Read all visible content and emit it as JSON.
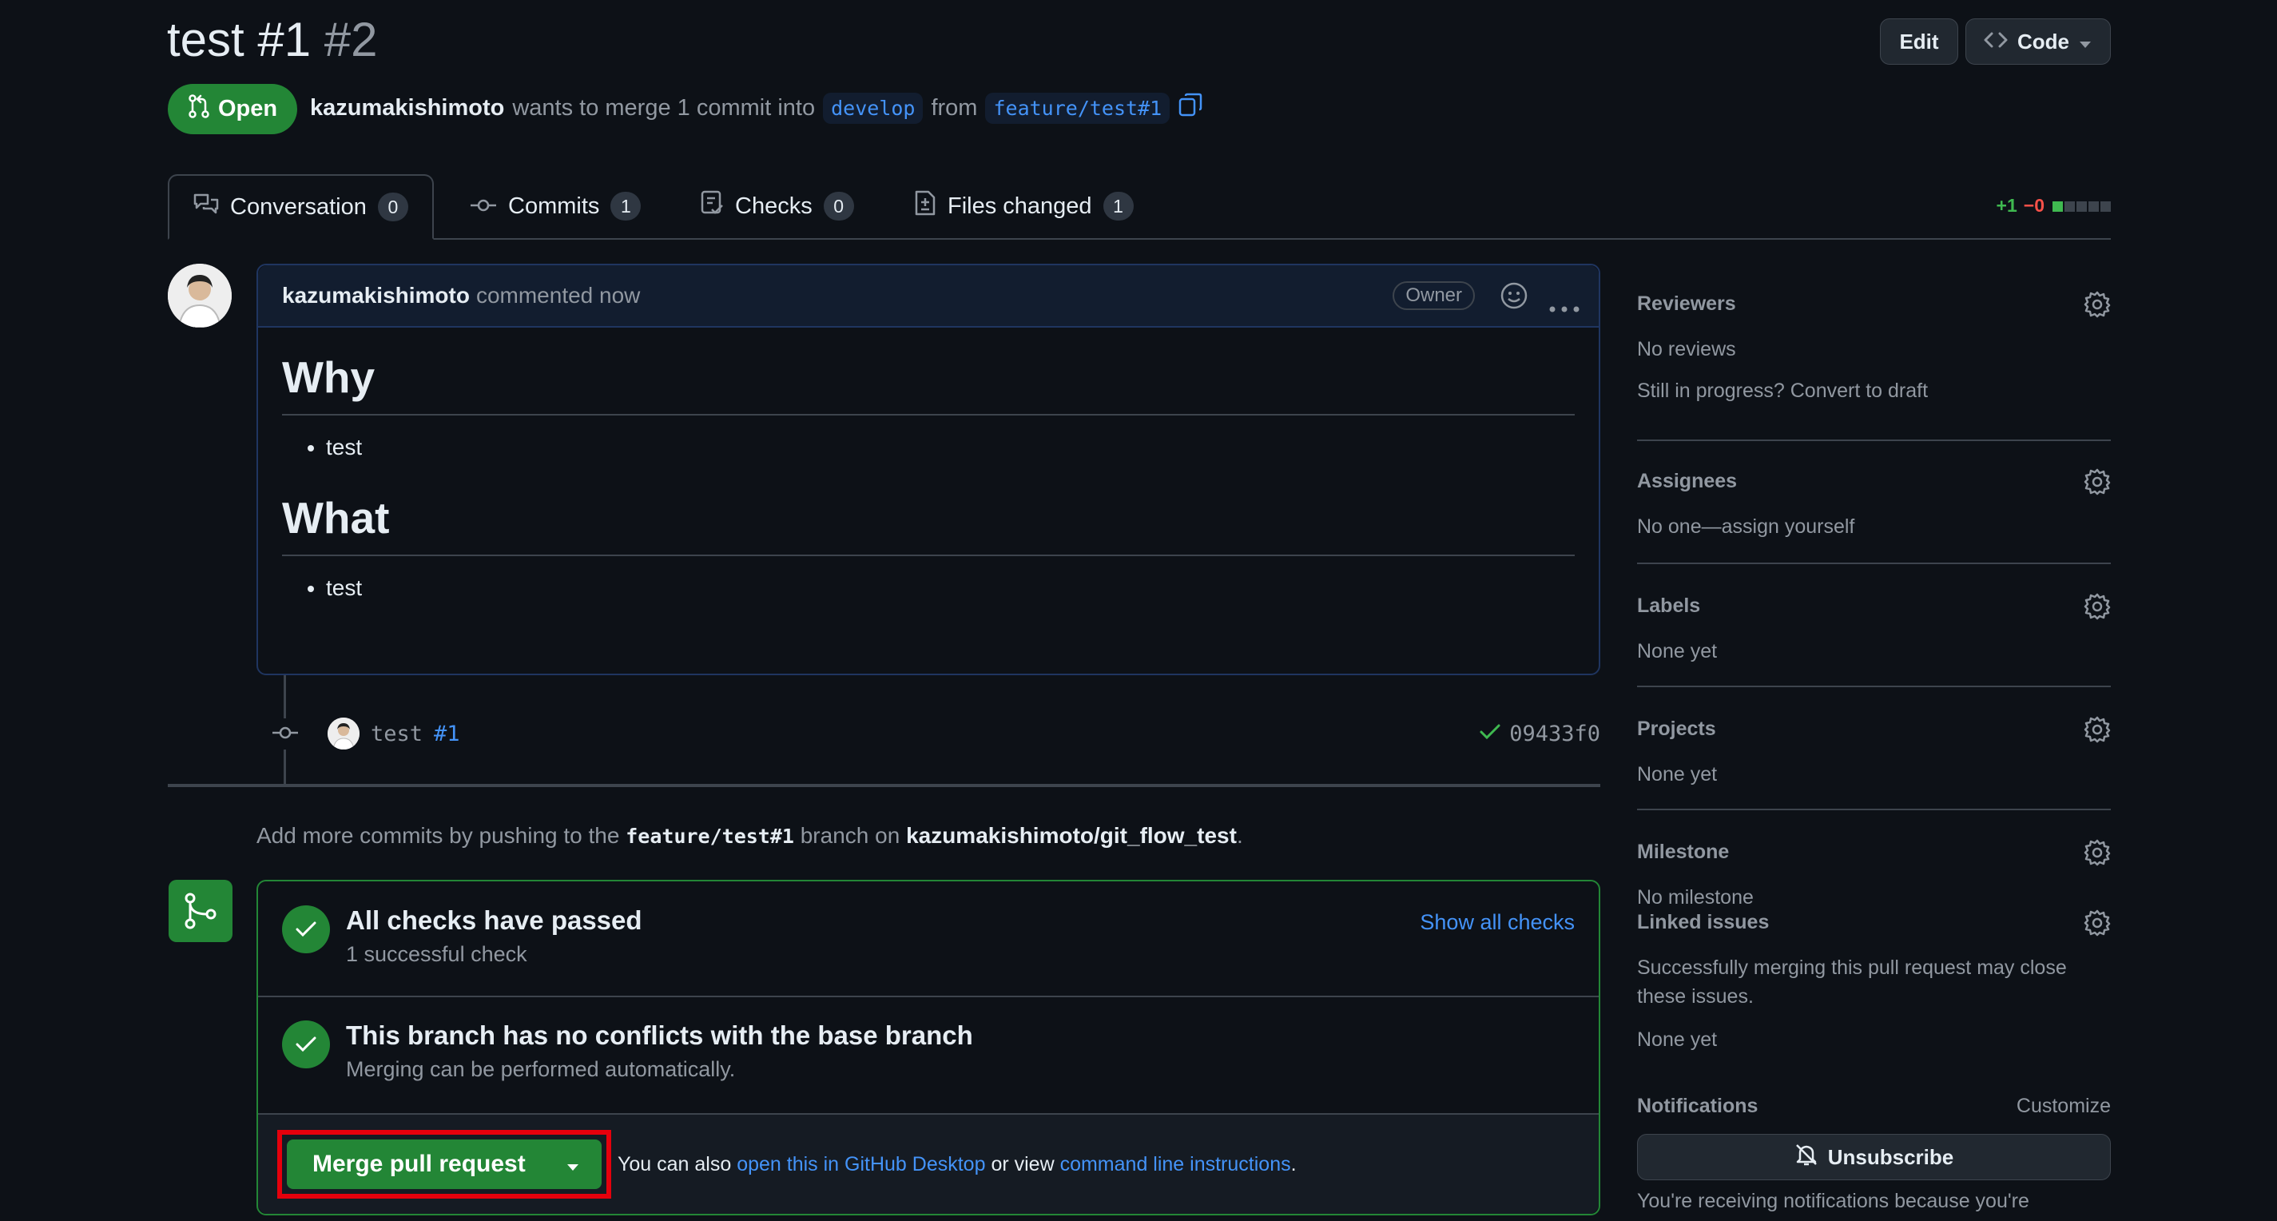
{
  "header": {
    "title": "test #1",
    "number": "#2",
    "edit_label": "Edit",
    "code_label": "Code",
    "state": "Open",
    "author": "kazumakishimoto",
    "merge_text": "wants to merge 1 commit into",
    "base_branch": "develop",
    "from_text": "from",
    "head_branch": "feature/test#1"
  },
  "tabs": [
    {
      "label": "Conversation",
      "count": "0"
    },
    {
      "label": "Commits",
      "count": "1"
    },
    {
      "label": "Checks",
      "count": "0"
    },
    {
      "label": "Files changed",
      "count": "1"
    }
  ],
  "diffstat": {
    "additions": "+1",
    "deletions": "−0"
  },
  "comment": {
    "author": "kazumakishimoto",
    "time": "commented now",
    "badge": "Owner",
    "h1": "Why",
    "item1": "test",
    "h2": "What",
    "item2": "test"
  },
  "commit": {
    "message": "test",
    "ref": "#1",
    "sha": "09433f0"
  },
  "hint": {
    "prefix": "Add more commits by pushing to the",
    "branch": "feature/test#1",
    "middle": "branch on",
    "repo": "kazumakishimoto/git_flow_test",
    "suffix": "."
  },
  "checks": {
    "title": "All checks have passed",
    "sub": "1 successful check",
    "show_all": "Show all checks"
  },
  "conflicts": {
    "title": "This branch has no conflicts with the base branch",
    "sub": "Merging can be performed automatically."
  },
  "merge": {
    "button": "Merge pull request",
    "also": "You can also",
    "desktop_link": "open this in GitHub Desktop",
    "or_view": "or view",
    "cli_link": "command line instructions",
    "end": "."
  },
  "sidebar": {
    "reviewers": {
      "title": "Reviewers",
      "text": "No reviews",
      "text2": "Still in progress? Convert to draft"
    },
    "assignees": {
      "title": "Assignees",
      "text": "No one—assign yourself"
    },
    "labels": {
      "title": "Labels",
      "text": "None yet"
    },
    "projects": {
      "title": "Projects",
      "text": "None yet"
    },
    "milestone": {
      "title": "Milestone",
      "text": "No milestone"
    },
    "linked": {
      "title": "Linked issues",
      "text": "Successfully merging this pull request may close these issues.",
      "text2": "None yet"
    },
    "notifications": {
      "title": "Notifications",
      "customize": "Customize",
      "unsubscribe": "Unsubscribe",
      "footer": "You're receiving notifications because you're"
    }
  },
  "colors": {
    "accent": "#238636",
    "link": "#4493f8",
    "highlight": "#e5000c",
    "background": "#0d1117"
  }
}
